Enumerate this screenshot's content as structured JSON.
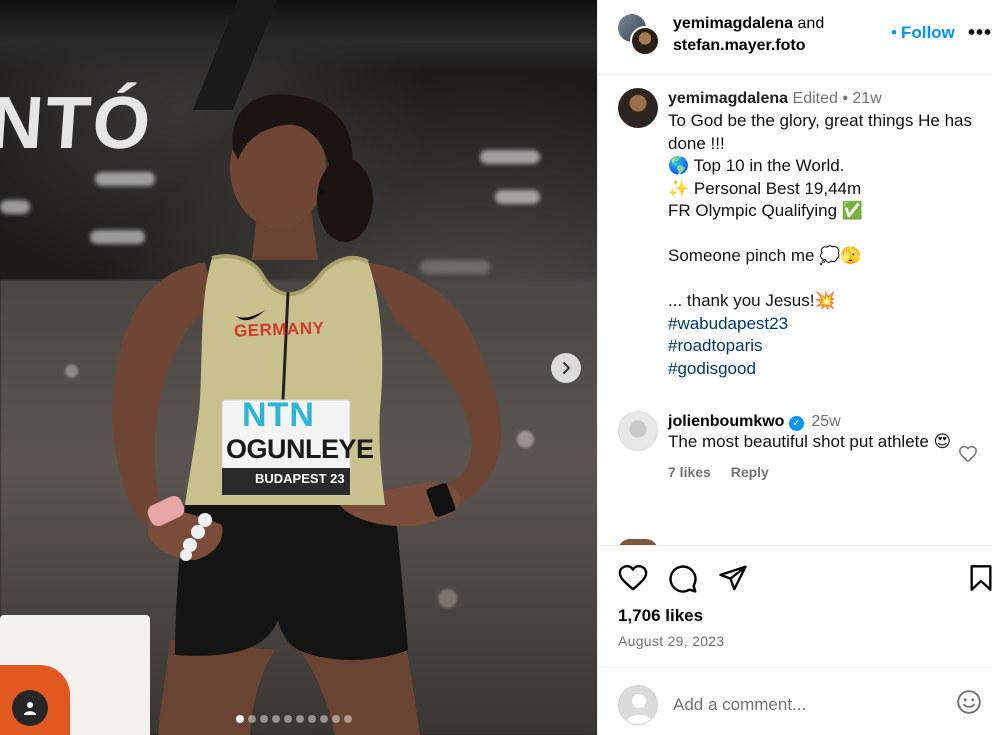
{
  "photo": {
    "sign_text": "NTÓ",
    "bib": {
      "sponsor": "NTN",
      "name": "OGUNLEYE",
      "event": "BUDAPEST 23"
    },
    "jersey_text": "GERMANY",
    "carousel": {
      "total": 10,
      "active_index": 0
    }
  },
  "header": {
    "user1": "yemimagdalena",
    "and": "and",
    "user2": "stefan.mayer.foto",
    "follow": "Follow",
    "more": "•••"
  },
  "caption": {
    "username": "yemimagdalena",
    "edited": "Edited",
    "sep": "•",
    "time": "21w",
    "lines": [
      "To God be the glory, great things He has done !!!",
      "🌎 Top 10 in the World.",
      "✨ Personal Best 19,44m",
      "FR Olympic Qualifying ✅",
      "",
      "Someone pinch me 💭🫣",
      "",
      "... thank you Jesus!💥"
    ],
    "hashtags": [
      "#wabudapest23",
      "#roadtoparis",
      "#godisgood"
    ]
  },
  "comment": {
    "username": "jolienboumkwo",
    "time": "25w",
    "text": "The most beautiful shot put athlete 😍",
    "likes": "7 likes",
    "reply": "Reply"
  },
  "post": {
    "likes": "1,706 likes",
    "date": "August 29, 2023"
  },
  "add_comment": {
    "placeholder": "Add a comment..."
  },
  "colors": {
    "link_blue": "#0095f6",
    "hashtag": "#00376b",
    "muted": "#737373"
  }
}
